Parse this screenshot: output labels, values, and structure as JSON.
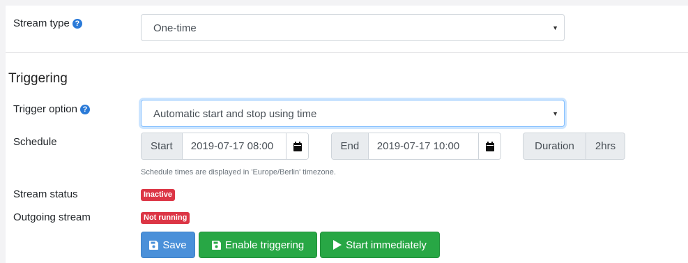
{
  "stream_type": {
    "label": "Stream type",
    "value": "One-time"
  },
  "triggering": {
    "heading": "Triggering",
    "trigger_option_label": "Trigger option",
    "trigger_option_value": "Automatic start and stop using time"
  },
  "schedule": {
    "label": "Schedule",
    "start_label": "Start",
    "start_value": "2019-07-17 08:00",
    "end_label": "End",
    "end_value": "2019-07-17 10:00",
    "duration_label": "Duration",
    "duration_value": "2hrs",
    "hint": "Schedule times are displayed in 'Europe/Berlin' timezone."
  },
  "status": {
    "stream_status_label": "Stream status",
    "stream_status_badge": "Inactive",
    "outgoing_label": "Outgoing stream",
    "outgoing_badge": "Not running"
  },
  "buttons": {
    "save": "Save",
    "enable_triggering": "Enable triggering",
    "start_immediately": "Start immediately"
  },
  "colors": {
    "primary": "#4a90d9",
    "success": "#28a745",
    "danger": "#dc3545",
    "help_icon": "#2a7ad8"
  }
}
